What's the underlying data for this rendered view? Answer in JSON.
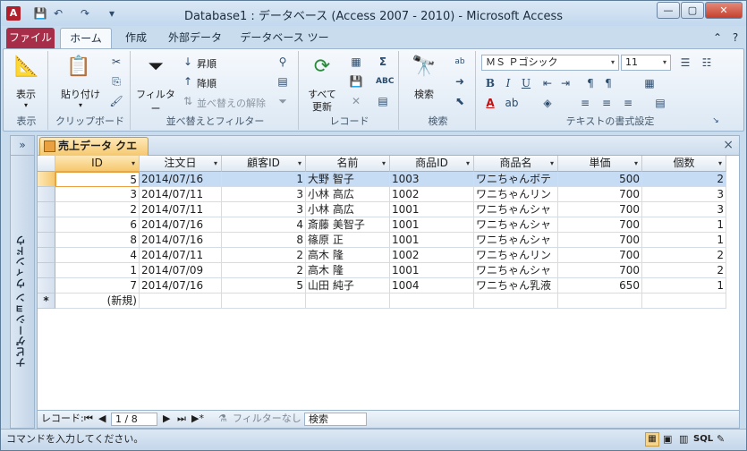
{
  "window": {
    "title": "Database1 : データベース (Access 2007 - 2010)  -  Microsoft Access",
    "app_icon": "A",
    "controls": {
      "minimize": "—",
      "maximize": "▢",
      "close": "✕"
    }
  },
  "qat": {
    "save": "💾",
    "undo": "↶",
    "redo": "↷",
    "customize": "▾"
  },
  "ribbon_tabs": {
    "file": "ファイル",
    "home": "ホーム",
    "create": "作成",
    "external": "外部データ",
    "dbtools": "データベース ツール"
  },
  "ribbon": {
    "views": {
      "view_label": "表示",
      "group_label": "表示"
    },
    "clipboard": {
      "paste_label": "貼り付け",
      "group_label": "クリップボード"
    },
    "sortfilter": {
      "filter_label": "フィルター",
      "ascending": "昇順",
      "descending": "降順",
      "remove_sort": "並べ替えの解除",
      "group_label": "並べ替えとフィルター"
    },
    "records": {
      "refresh_label1": "すべて",
      "refresh_label2": "更新",
      "group_label": "レコード"
    },
    "find": {
      "find_label": "検索",
      "group_label": "検索"
    },
    "textformat": {
      "font_name": "ＭＳ Ｐゴシック",
      "font_size": "11",
      "group_label": "テキストの書式設定"
    }
  },
  "nav_pane": {
    "label": "ナビゲーション ウィンドウ",
    "toggle": "»"
  },
  "document": {
    "tab_label": "売上データ クエリ",
    "close": "×"
  },
  "grid": {
    "columns": [
      "ID",
      "注文日",
      "顧客ID",
      "名前",
      "商品ID",
      "商品名",
      "単価",
      "個数"
    ],
    "rows": [
      [
        "5",
        "2014/07/16",
        "1",
        "大野 智子",
        "1003",
        "ワニちゃんボテ",
        "500",
        "2"
      ],
      [
        "3",
        "2014/07/11",
        "3",
        "小林 高広",
        "1002",
        "ワニちゃんリン",
        "700",
        "3"
      ],
      [
        "2",
        "2014/07/11",
        "3",
        "小林 高広",
        "1001",
        "ワニちゃんシャ",
        "700",
        "3"
      ],
      [
        "6",
        "2014/07/16",
        "4",
        "斎藤 美智子",
        "1001",
        "ワニちゃんシャ",
        "700",
        "1"
      ],
      [
        "8",
        "2014/07/16",
        "8",
        "篠原 正",
        "1001",
        "ワニちゃんシャ",
        "700",
        "1"
      ],
      [
        "4",
        "2014/07/11",
        "2",
        "高木 隆",
        "1002",
        "ワニちゃんリン",
        "700",
        "2"
      ],
      [
        "1",
        "2014/07/09",
        "2",
        "高木 隆",
        "1001",
        "ワニちゃんシャ",
        "700",
        "2"
      ],
      [
        "7",
        "2014/07/16",
        "5",
        "山田 純子",
        "1004",
        "ワニちゃん乳液",
        "650",
        "1"
      ]
    ],
    "new_row_marker": "*",
    "new_row_label": "(新規)"
  },
  "recordnav": {
    "label": "レコード:",
    "position": "1 / 8",
    "first": "⏮",
    "prev": "◀",
    "next": "▶",
    "last": "⏭",
    "new": "▶*",
    "filter_status": "フィルターなし",
    "search_value": "検索"
  },
  "statusbar": {
    "text": "コマンドを入力してください。",
    "view_sql": "SQL"
  }
}
